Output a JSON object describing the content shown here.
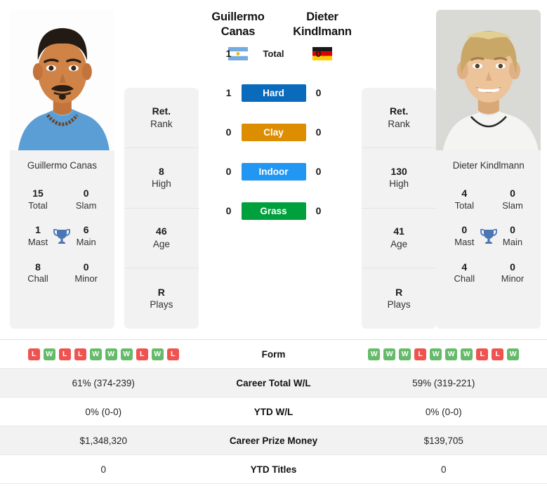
{
  "players": {
    "left": {
      "first_name": "Guillermo",
      "last_name": "Canas",
      "full_name": "Guillermo Canas",
      "country": "Argentina",
      "flag": "argentina-flag",
      "titles": {
        "total": "15",
        "total_label": "Total",
        "slam": "0",
        "slam_label": "Slam",
        "mast": "1",
        "mast_label": "Mast",
        "main": "6",
        "main_label": "Main",
        "chall": "8",
        "chall_label": "Chall",
        "minor": "0",
        "minor_label": "Minor"
      },
      "details": [
        {
          "value": "Ret.",
          "label": "Rank"
        },
        {
          "value": "8",
          "label": "High"
        },
        {
          "value": "46",
          "label": "Age"
        },
        {
          "value": "R",
          "label": "Plays"
        }
      ],
      "form": [
        "L",
        "W",
        "L",
        "L",
        "W",
        "W",
        "W",
        "L",
        "W",
        "L"
      ],
      "career_total_wl": "61% (374-239)",
      "ytd_wl": "0% (0-0)",
      "career_prize_money": "$1,348,320",
      "ytd_titles": "0"
    },
    "right": {
      "first_name": "Dieter",
      "last_name": "Kindlmann",
      "full_name": "Dieter Kindlmann",
      "country": "Germany",
      "flag": "germany-flag",
      "titles": {
        "total": "4",
        "total_label": "Total",
        "slam": "0",
        "slam_label": "Slam",
        "mast": "0",
        "mast_label": "Mast",
        "main": "0",
        "main_label": "Main",
        "chall": "4",
        "chall_label": "Chall",
        "minor": "0",
        "minor_label": "Minor"
      },
      "details": [
        {
          "value": "Ret.",
          "label": "Rank"
        },
        {
          "value": "130",
          "label": "High"
        },
        {
          "value": "41",
          "label": "Age"
        },
        {
          "value": "R",
          "label": "Plays"
        }
      ],
      "form": [
        "W",
        "W",
        "W",
        "L",
        "W",
        "W",
        "W",
        "L",
        "L",
        "W"
      ],
      "career_total_wl": "59% (319-221)",
      "ytd_wl": "0% (0-0)",
      "career_prize_money": "$139,705",
      "ytd_titles": "0"
    }
  },
  "head_to_head": {
    "surfaces": [
      {
        "label": "Total",
        "left": "1",
        "right": "0",
        "color": "",
        "badge": false
      },
      {
        "label": "Hard",
        "left": "1",
        "right": "0",
        "color": "#0a6bbd",
        "badge": true
      },
      {
        "label": "Clay",
        "left": "0",
        "right": "0",
        "color": "#dd8d00",
        "badge": true
      },
      {
        "label": "Indoor",
        "left": "0",
        "right": "0",
        "color": "#2196f3",
        "badge": true
      },
      {
        "label": "Grass",
        "left": "0",
        "right": "0",
        "color": "#00a03c",
        "badge": true
      }
    ]
  },
  "stats_table": {
    "rows": [
      {
        "label": "Form",
        "type": "form"
      },
      {
        "label": "Career Total W/L",
        "type": "text",
        "key": "career_total_wl"
      },
      {
        "label": "YTD W/L",
        "type": "text",
        "key": "ytd_wl"
      },
      {
        "label": "Career Prize Money",
        "type": "text",
        "key": "career_prize_money"
      },
      {
        "label": "YTD Titles",
        "type": "text",
        "key": "ytd_titles"
      }
    ]
  },
  "icons": {
    "trophy": "trophy-icon"
  },
  "colors": {
    "win": "#66bb6a",
    "loss": "#ef5350",
    "trophy": "#4a77b4",
    "card_bg": "#f2f2f2"
  }
}
